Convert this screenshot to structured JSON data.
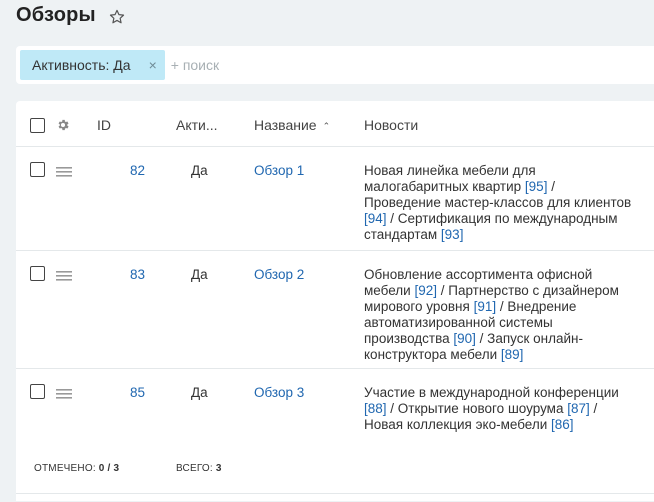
{
  "page": {
    "title": "Обзоры"
  },
  "filter": {
    "chip_label": "Активность: Да",
    "chip_close": "×",
    "search_placeholder": "+ поиск"
  },
  "table": {
    "columns": {
      "id": "ID",
      "active": "Акти...",
      "name": "Название",
      "news": "Новости"
    },
    "sort_indicator": "⌃",
    "rows": [
      {
        "id": "82",
        "active": "Да",
        "name": "Обзор 1",
        "news": [
          {
            "text": "Новая линейка мебели для малогабаритных квартир ",
            "ref": "[95]"
          },
          {
            "text": " / Проведение мастер-классов для клиентов ",
            "ref": "[94]"
          },
          {
            "text": " / Сертификация по международным стандартам ",
            "ref": "[93]"
          }
        ]
      },
      {
        "id": "83",
        "active": "Да",
        "name": "Обзор 2",
        "news": [
          {
            "text": "Обновление ассортимента офисной мебели ",
            "ref": "[92]"
          },
          {
            "text": " / Партнерство с дизайнером мирового уровня ",
            "ref": "[91]"
          },
          {
            "text": " / Внедрение автоматизированной системы производства ",
            "ref": "[90]"
          },
          {
            "text": " / Запуск онлайн-конструктора мебели ",
            "ref": "[89]"
          }
        ]
      },
      {
        "id": "85",
        "active": "Да",
        "name": "Обзор 3",
        "news": [
          {
            "text": "Участие в международной конференции ",
            "ref": "[88]"
          },
          {
            "text": " / Открытие нового шоурума ",
            "ref": "[87]"
          },
          {
            "text": " / Новая коллекция эко-мебели ",
            "ref": "[86]"
          }
        ]
      }
    ]
  },
  "footer": {
    "selected_label": "ОТМЕЧЕНО:",
    "selected_value": "0 / 3",
    "total_label": "ВСЕГО:",
    "total_value": "3"
  },
  "colors": {
    "accent_link": "#2067b0",
    "chip_bg": "#bfe9f7",
    "page_bg": "#eef2f4"
  },
  "icons": [
    "star-icon",
    "gear-icon",
    "drag-handle-icon",
    "close-icon"
  ]
}
